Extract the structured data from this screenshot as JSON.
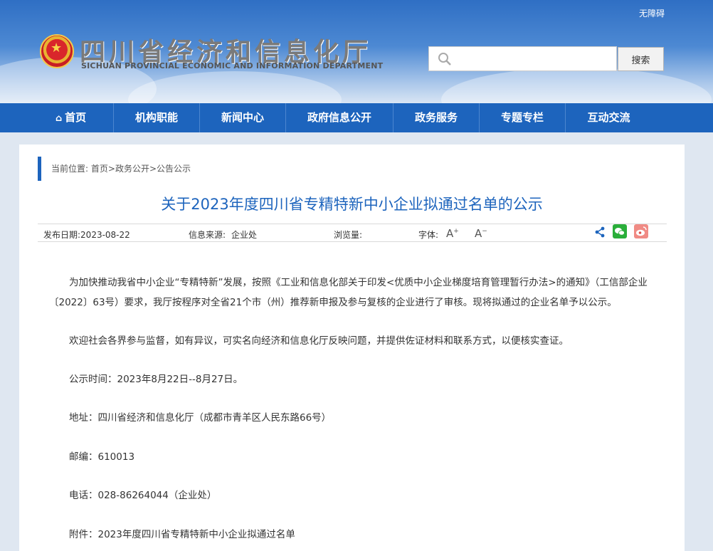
{
  "header": {
    "accessibility_label": "无障碍",
    "site_title": "四川省经济和信息化厅",
    "site_title_en": "SICHUAN PROVINCIAL ECONOMIC AND INFORMATION DEPARTMENT",
    "search_placeholder": "",
    "search_button": "搜索",
    "emblem_icon": "national-emblem-icon",
    "search_icon": "magnifier-icon"
  },
  "nav": {
    "items": [
      {
        "label": "首页",
        "icon": "home-icon"
      },
      {
        "label": "机构职能"
      },
      {
        "label": "新闻中心"
      },
      {
        "label": "政府信息公开"
      },
      {
        "label": "政务服务"
      },
      {
        "label": "专题专栏"
      },
      {
        "label": "互动交流"
      }
    ]
  },
  "breadcrumb": {
    "prefix": "当前位置:",
    "items": [
      "首页",
      "政务公开",
      "公告公示"
    ],
    "separator": ">"
  },
  "article": {
    "title": "关于2023年度四川省专精特新中小企业拟通过名单的公示",
    "meta": {
      "publish_date": "发布日期:2023-08-22",
      "source_label": "信息来源:",
      "source_value": "企业处",
      "views_label": "浏览量:",
      "views_value": "",
      "font_label": "字体:",
      "font_increase": "A",
      "font_decrease": "A"
    },
    "share_icons": [
      "share-icon",
      "wechat-icon",
      "weibo-icon"
    ],
    "paragraphs": [
      "为加快推动我省中小企业“专精特新”发展，按照《工业和信息化部关于印发<优质中小企业梯度培育管理暂行办法>的通知》（工信部企业〔2022〕63号）要求，我厅按程序对全省21个市（州）推荐新申报及参与复核的企业进行了审核。现将拟通过的企业名单予以公示。",
      "欢迎社会各界参与监督，如有异议，可实名向经济和信息化厅反映问题，并提供佐证材料和联系方式，以便核实查证。",
      "公示时间：2023年8月22日--8月27日。",
      "地址：四川省经济和信息化厅（成都市青羊区人民东路66号）",
      "邮编：610013",
      "电话：028-86264044（企业处）",
      "附件：2023年度四川省专精特新中小企业拟通过名单"
    ]
  },
  "colors": {
    "brand_blue": "#1d64bd",
    "title_blue": "#1d64bd",
    "page_bg": "#dfe7f1"
  }
}
